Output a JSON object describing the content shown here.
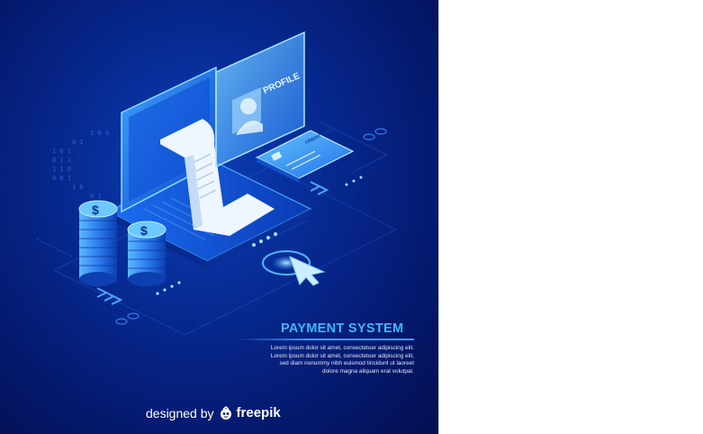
{
  "poster": {
    "title": "PAYMENT SYSTEM",
    "body_lines": [
      "Lorem ipsum dolor sit amet, consectetuer adipiscing elit.",
      "Lorem ipsum dolor sit amet, consectetuer adipiscing elit,",
      "sed diam nonummy nibh euismod tincidunt ut laoreet",
      "dolore magna aliquam erat volutpat."
    ],
    "profile_label": "PROFILE",
    "card_label": "CREDIT CARD",
    "coin_symbol": "$"
  },
  "credit": {
    "designed_by": "designed by",
    "brand": "freepik"
  },
  "colors": {
    "background_dark": "#041564",
    "accent_blue": "#3fb6ff",
    "glow": "#6fd3ff"
  }
}
